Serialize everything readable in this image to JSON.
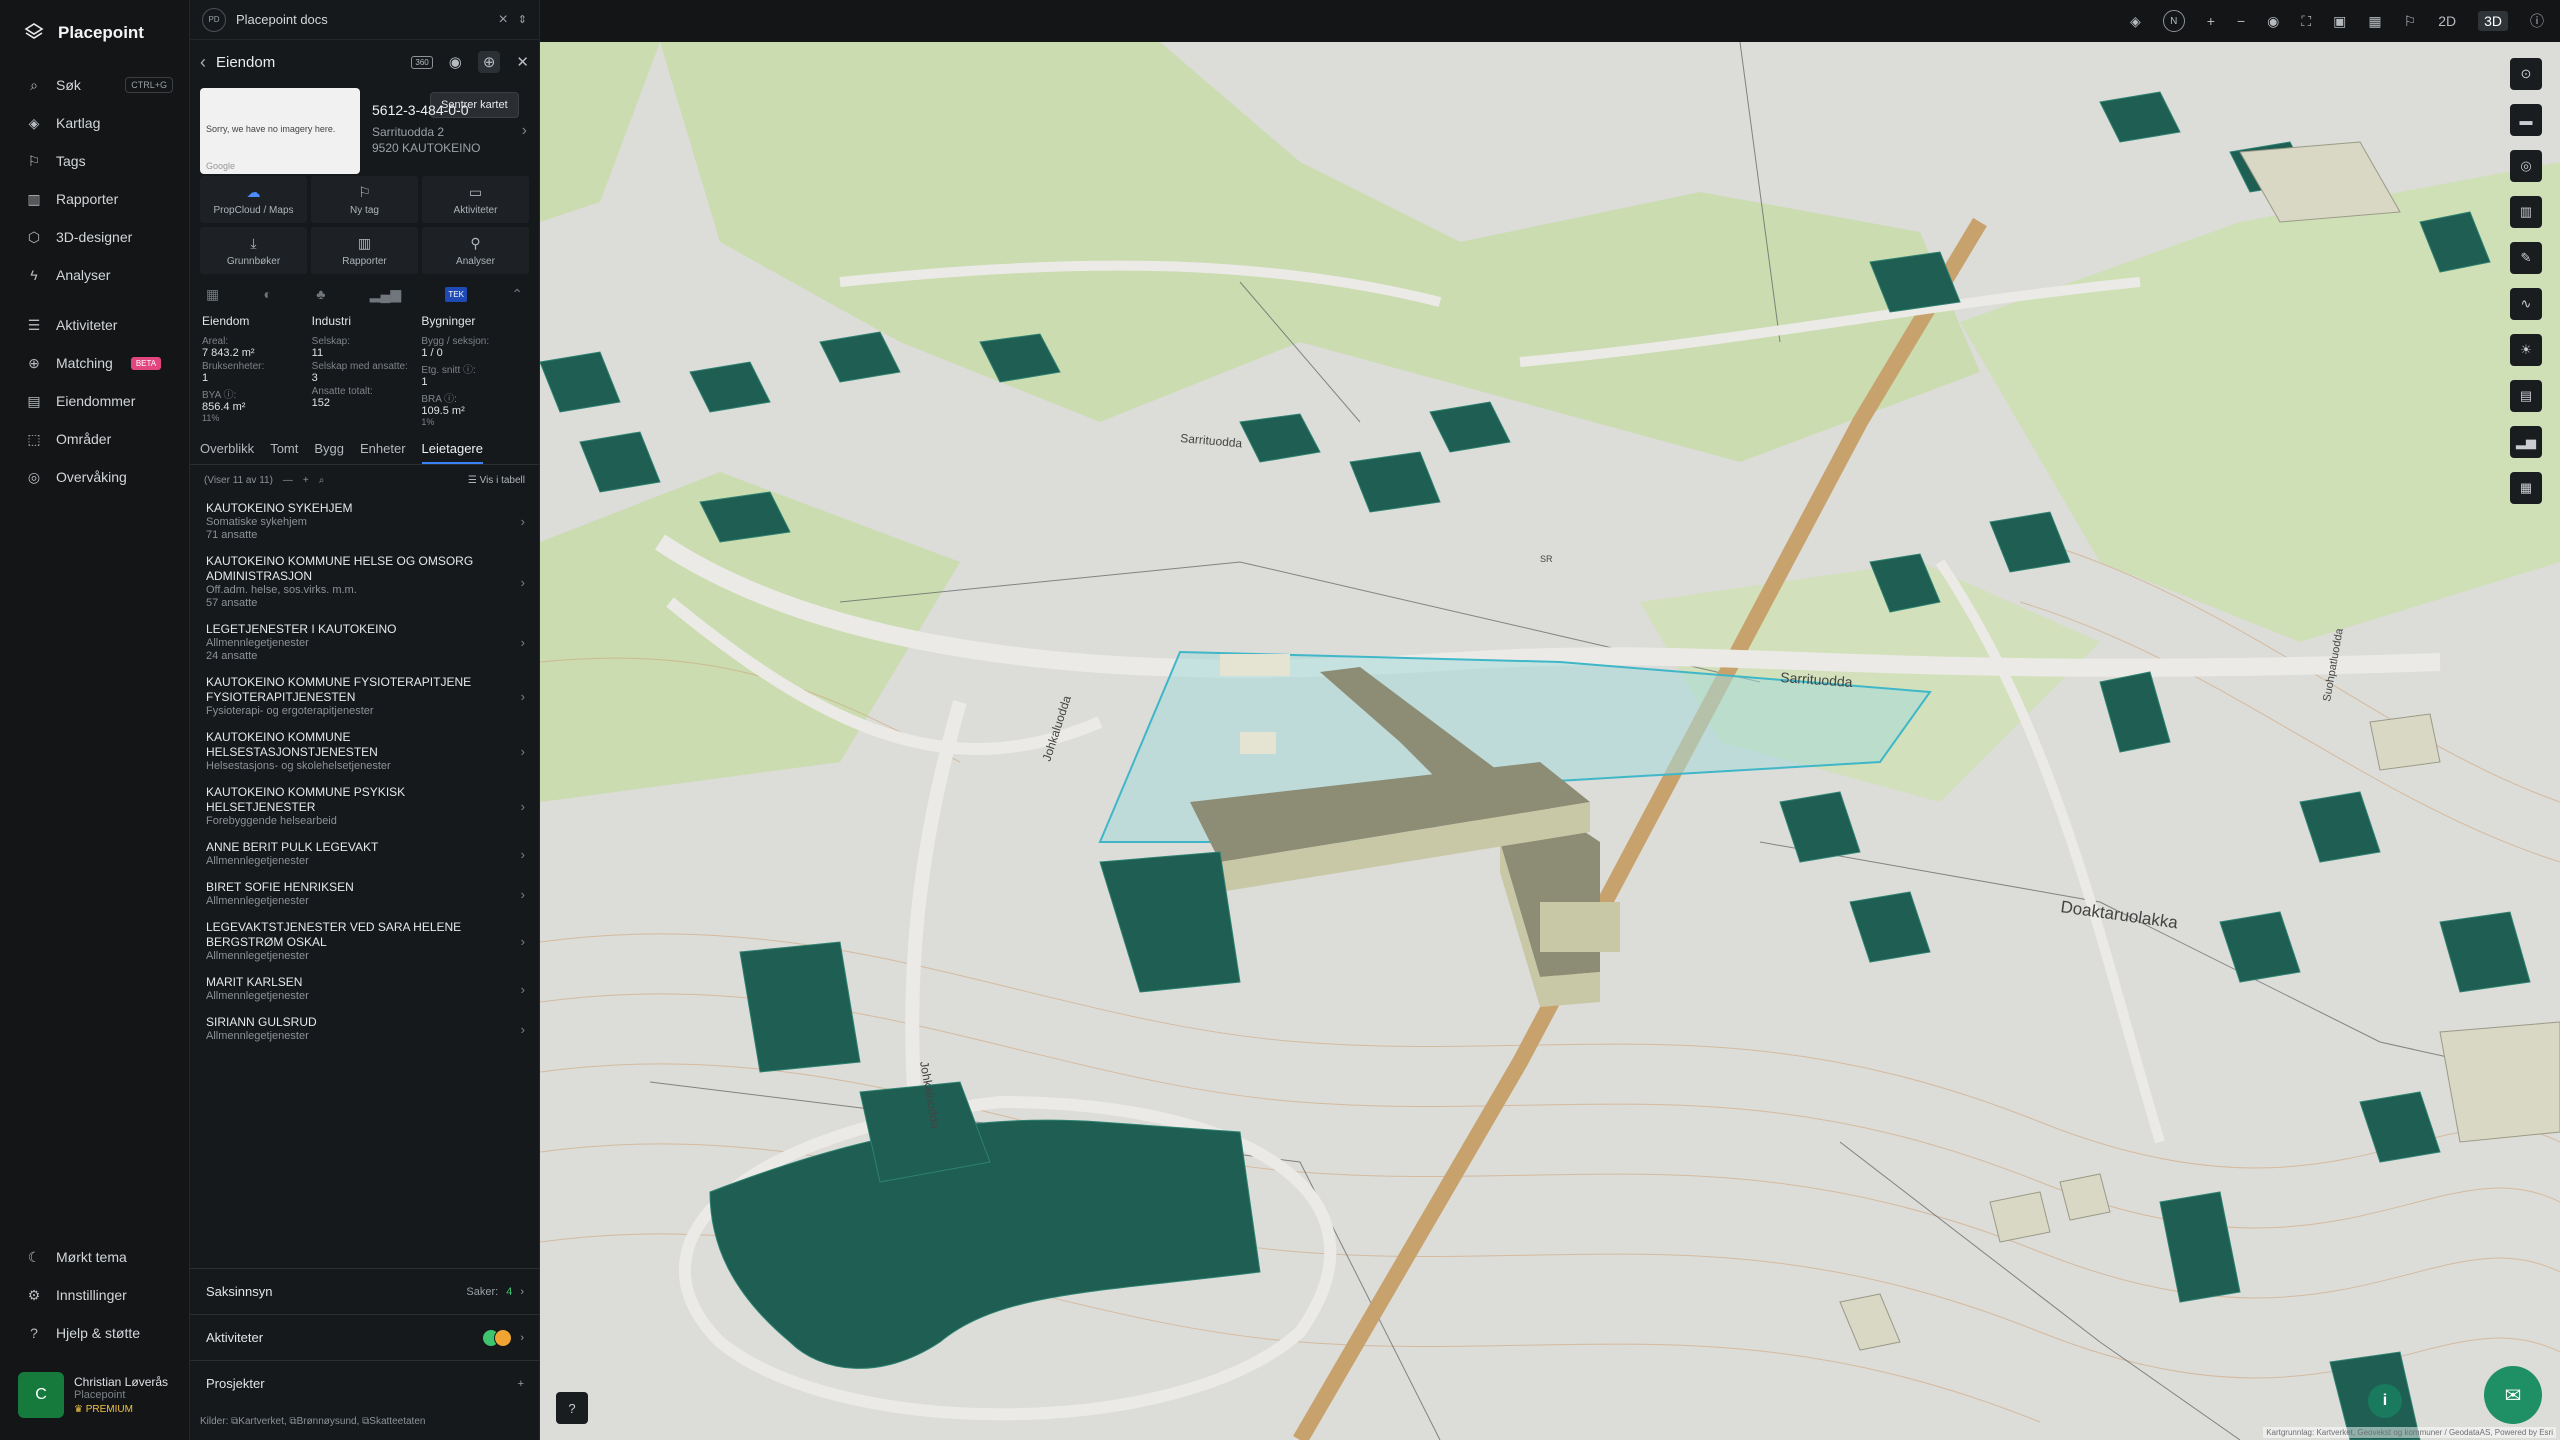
{
  "app": {
    "name": "Placepoint"
  },
  "nav": {
    "items": [
      {
        "label": "Søk",
        "shortcut": "CTRL+G"
      },
      {
        "label": "Kartlag"
      },
      {
        "label": "Tags"
      },
      {
        "label": "Rapporter"
      },
      {
        "label": "3D-designer"
      },
      {
        "label": "Analyser"
      },
      {
        "label": "Aktiviteter"
      },
      {
        "label": "Matching",
        "badge": "BETA"
      },
      {
        "label": "Eiendommer"
      },
      {
        "label": "Områder"
      },
      {
        "label": "Overvåking"
      }
    ],
    "bottom": [
      {
        "label": "Mørkt tema"
      },
      {
        "label": "Innstillinger"
      },
      {
        "label": "Hjelp & støtte"
      }
    ]
  },
  "user": {
    "initial": "C",
    "name": "Christian Løverås",
    "org": "Placepoint",
    "plan": "PREMIUM"
  },
  "doc_tab": {
    "badge": "PD",
    "title": "Placepoint docs"
  },
  "panel": {
    "title": "Eiendom",
    "tool_360": "360",
    "tooltip": "Sentrer kartet",
    "thumb_text": "Sorry, we have no imagery here.",
    "thumb_brand": "Google",
    "property": {
      "id": "5612-3-484-0-0",
      "street": "Sarrituodda 2",
      "city": "9520 KAUTOKEINO"
    },
    "actions": [
      "PropCloud / Maps",
      "Ny tag",
      "Aktiviteter",
      "Grunnbøker",
      "Rapporter",
      "Analyser"
    ],
    "tek": "TEK",
    "stats": {
      "eiendom": {
        "head": "Eiendom",
        "areal_l": "Areal:",
        "areal_v": "7 843.2 m²",
        "bruks_l": "Bruksenheter:",
        "bruks_v": "1",
        "bya_l": "BYA ⓘ:",
        "bya_v": "856.4 m²",
        "bya_p": "11%"
      },
      "industri": {
        "head": "Industri",
        "selskap_l": "Selskap:",
        "selskap_v": "11",
        "ansatte_l": "Selskap med ansatte:",
        "ansatte_v": "3",
        "total_l": "Ansatte totalt:",
        "total_v": "152"
      },
      "bygninger": {
        "head": "Bygninger",
        "bygg_l": "Bygg / seksjon:",
        "bygg_v": "1 / 0",
        "etg_l": "Etg. snitt ⓘ:",
        "etg_v": "1",
        "bra_l": "BRA ⓘ:",
        "bra_v": "109.5 m²",
        "bra_p": "1%"
      }
    },
    "tabs": [
      "Overblikk",
      "Tomt",
      "Bygg",
      "Enheter",
      "Leietagere"
    ],
    "list_count": "(Viser 11 av 11)",
    "view_table": "Vis i tabell",
    "tenants": [
      {
        "name": "KAUTOKEINO SYKEHJEM",
        "cat": "Somatiske sykehjem",
        "emp": "71 ansatte"
      },
      {
        "name": "KAUTOKEINO KOMMUNE HELSE OG OMSORG ADMINISTRASJON",
        "cat": "Off.adm. helse, sos.virks. m.m.",
        "emp": "57 ansatte"
      },
      {
        "name": "LEGETJENESTER I KAUTOKEINO",
        "cat": "Allmennlegetjenester",
        "emp": "24 ansatte"
      },
      {
        "name": "KAUTOKEINO KOMMUNE FYSIOTERAPITJENE FYSIOTERAPITJENESTEN",
        "cat": "Fysioterapi- og ergoterapitjenester",
        "emp": ""
      },
      {
        "name": "KAUTOKEINO KOMMUNE HELSESTASJONSTJENESTEN",
        "cat": "Helsestasjons- og skolehelsetjenester",
        "emp": ""
      },
      {
        "name": "KAUTOKEINO KOMMUNE PSYKISK HELSETJENESTER",
        "cat": "Forebyggende helsearbeid",
        "emp": ""
      },
      {
        "name": "ANNE BERIT PULK LEGEVAKT",
        "cat": "Allmennlegetjenester",
        "emp": ""
      },
      {
        "name": "BIRET SOFIE HENRIKSEN",
        "cat": "Allmennlegetjenester",
        "emp": ""
      },
      {
        "name": "LEGEVAKTSTJENESTER VED SARA HELENE BERGSTRØM OSKAL",
        "cat": "Allmennlegetjenester",
        "emp": ""
      },
      {
        "name": "MARIT KARLSEN",
        "cat": "Allmennlegetjenester",
        "emp": ""
      },
      {
        "name": "SIRIANN GULSRUD",
        "cat": "Allmennlegetjenester",
        "emp": ""
      }
    ],
    "saksinnsyn": {
      "label": "Saksinnsyn",
      "count_label": "Saker:",
      "count": "4"
    },
    "aktiviteter": {
      "label": "Aktiviteter"
    },
    "prosjekter": {
      "label": "Prosjekter"
    },
    "sources": {
      "label": "Kilder:",
      "a": "Kartverket,",
      "b": "Brønnøysund,",
      "c": "Skatteetaten"
    }
  },
  "map": {
    "mode_2d": "2D",
    "mode_3d": "3D",
    "compass": "N",
    "labels": {
      "road1": "Sarrituodda",
      "road2": "Sarrituodda",
      "road3": "Johkaluodda",
      "road4": "Johkaluodda",
      "road5": "Doaktaruolakka",
      "road6": "Suohpatluodda",
      "sr": "SR"
    },
    "attribution": "Kartgrunnlag: Kartverket, Geovekst og kommuner / GeodataAS, Powered by Esri"
  },
  "colors": {
    "building": "#1f5e52",
    "highlight": "#9fd6d8",
    "road": "#c9a36a",
    "green": "#c8dcae"
  }
}
